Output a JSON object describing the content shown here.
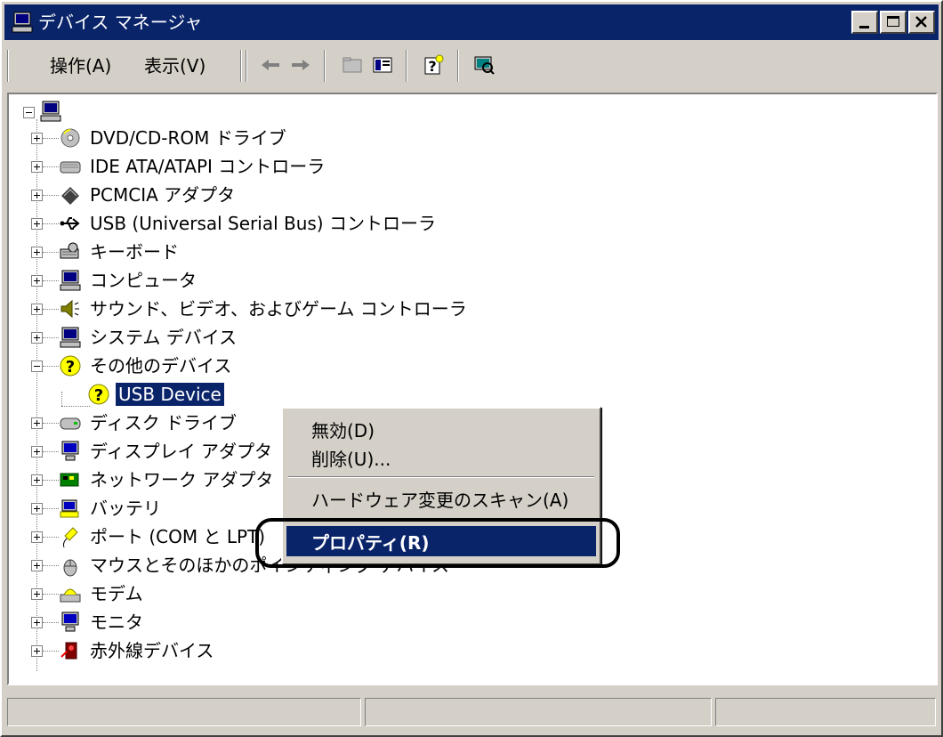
{
  "window": {
    "title": "デバイス マネージャ"
  },
  "menu": {
    "action": "操作(A)",
    "view": "表示(V)"
  },
  "toolbar": {
    "back": "back-arrow-icon",
    "forward": "forward-arrow-icon",
    "up": "folder-up-icon",
    "properties": "properties-icon",
    "help": "help-icon",
    "scan": "scan-hardware-icon"
  },
  "tree": {
    "root_icon": "computer-icon",
    "items": [
      {
        "label": "DVD/CD-ROM ドライブ",
        "icon": "cdrom-icon",
        "expanded": false
      },
      {
        "label": "IDE ATA/ATAPI コントローラ",
        "icon": "ide-icon",
        "expanded": false
      },
      {
        "label": "PCMCIA アダプタ",
        "icon": "pcmcia-icon",
        "expanded": false
      },
      {
        "label": "USB (Universal Serial Bus) コントローラ",
        "icon": "usb-icon",
        "expanded": false
      },
      {
        "label": "キーボード",
        "icon": "keyboard-icon",
        "expanded": false
      },
      {
        "label": "コンピュータ",
        "icon": "computer-icon",
        "expanded": false
      },
      {
        "label": "サウンド、ビデオ、およびゲーム コントローラ",
        "icon": "speaker-icon",
        "expanded": false
      },
      {
        "label": "システム デバイス",
        "icon": "system-icon",
        "expanded": false
      },
      {
        "label": "その他のデバイス",
        "icon": "unknown-device-icon",
        "expanded": true
      },
      {
        "label": "USB Device",
        "icon": "unknown-device-icon",
        "child": true,
        "selected": true
      },
      {
        "label": "ディスク ドライブ",
        "icon": "disk-icon",
        "expanded": false
      },
      {
        "label": "ディスプレイ アダプタ",
        "icon": "display-icon",
        "expanded": false
      },
      {
        "label": "ネットワーク アダプタ",
        "icon": "network-icon",
        "expanded": false
      },
      {
        "label": "バッテリ",
        "icon": "battery-icon",
        "expanded": false
      },
      {
        "label": "ポート (COM と LPT)",
        "icon": "port-icon",
        "expanded": false
      },
      {
        "label": "マウスとそのほかのポインティング デバイス",
        "icon": "mouse-icon",
        "expanded": false
      },
      {
        "label": "モデム",
        "icon": "modem-icon",
        "expanded": false
      },
      {
        "label": "モニタ",
        "icon": "monitor-icon",
        "expanded": false
      },
      {
        "label": "赤外線デバイス",
        "icon": "infrared-icon",
        "expanded": false
      }
    ]
  },
  "context_menu": {
    "disable": "無効(D)",
    "uninstall": "削除(U)...",
    "scan": "ハードウェア変更のスキャン(A)",
    "properties": "プロパティ(R)"
  },
  "colors": {
    "titlebar": "#0a246a",
    "selection": "#0a246a",
    "face": "#d4d0c8"
  }
}
